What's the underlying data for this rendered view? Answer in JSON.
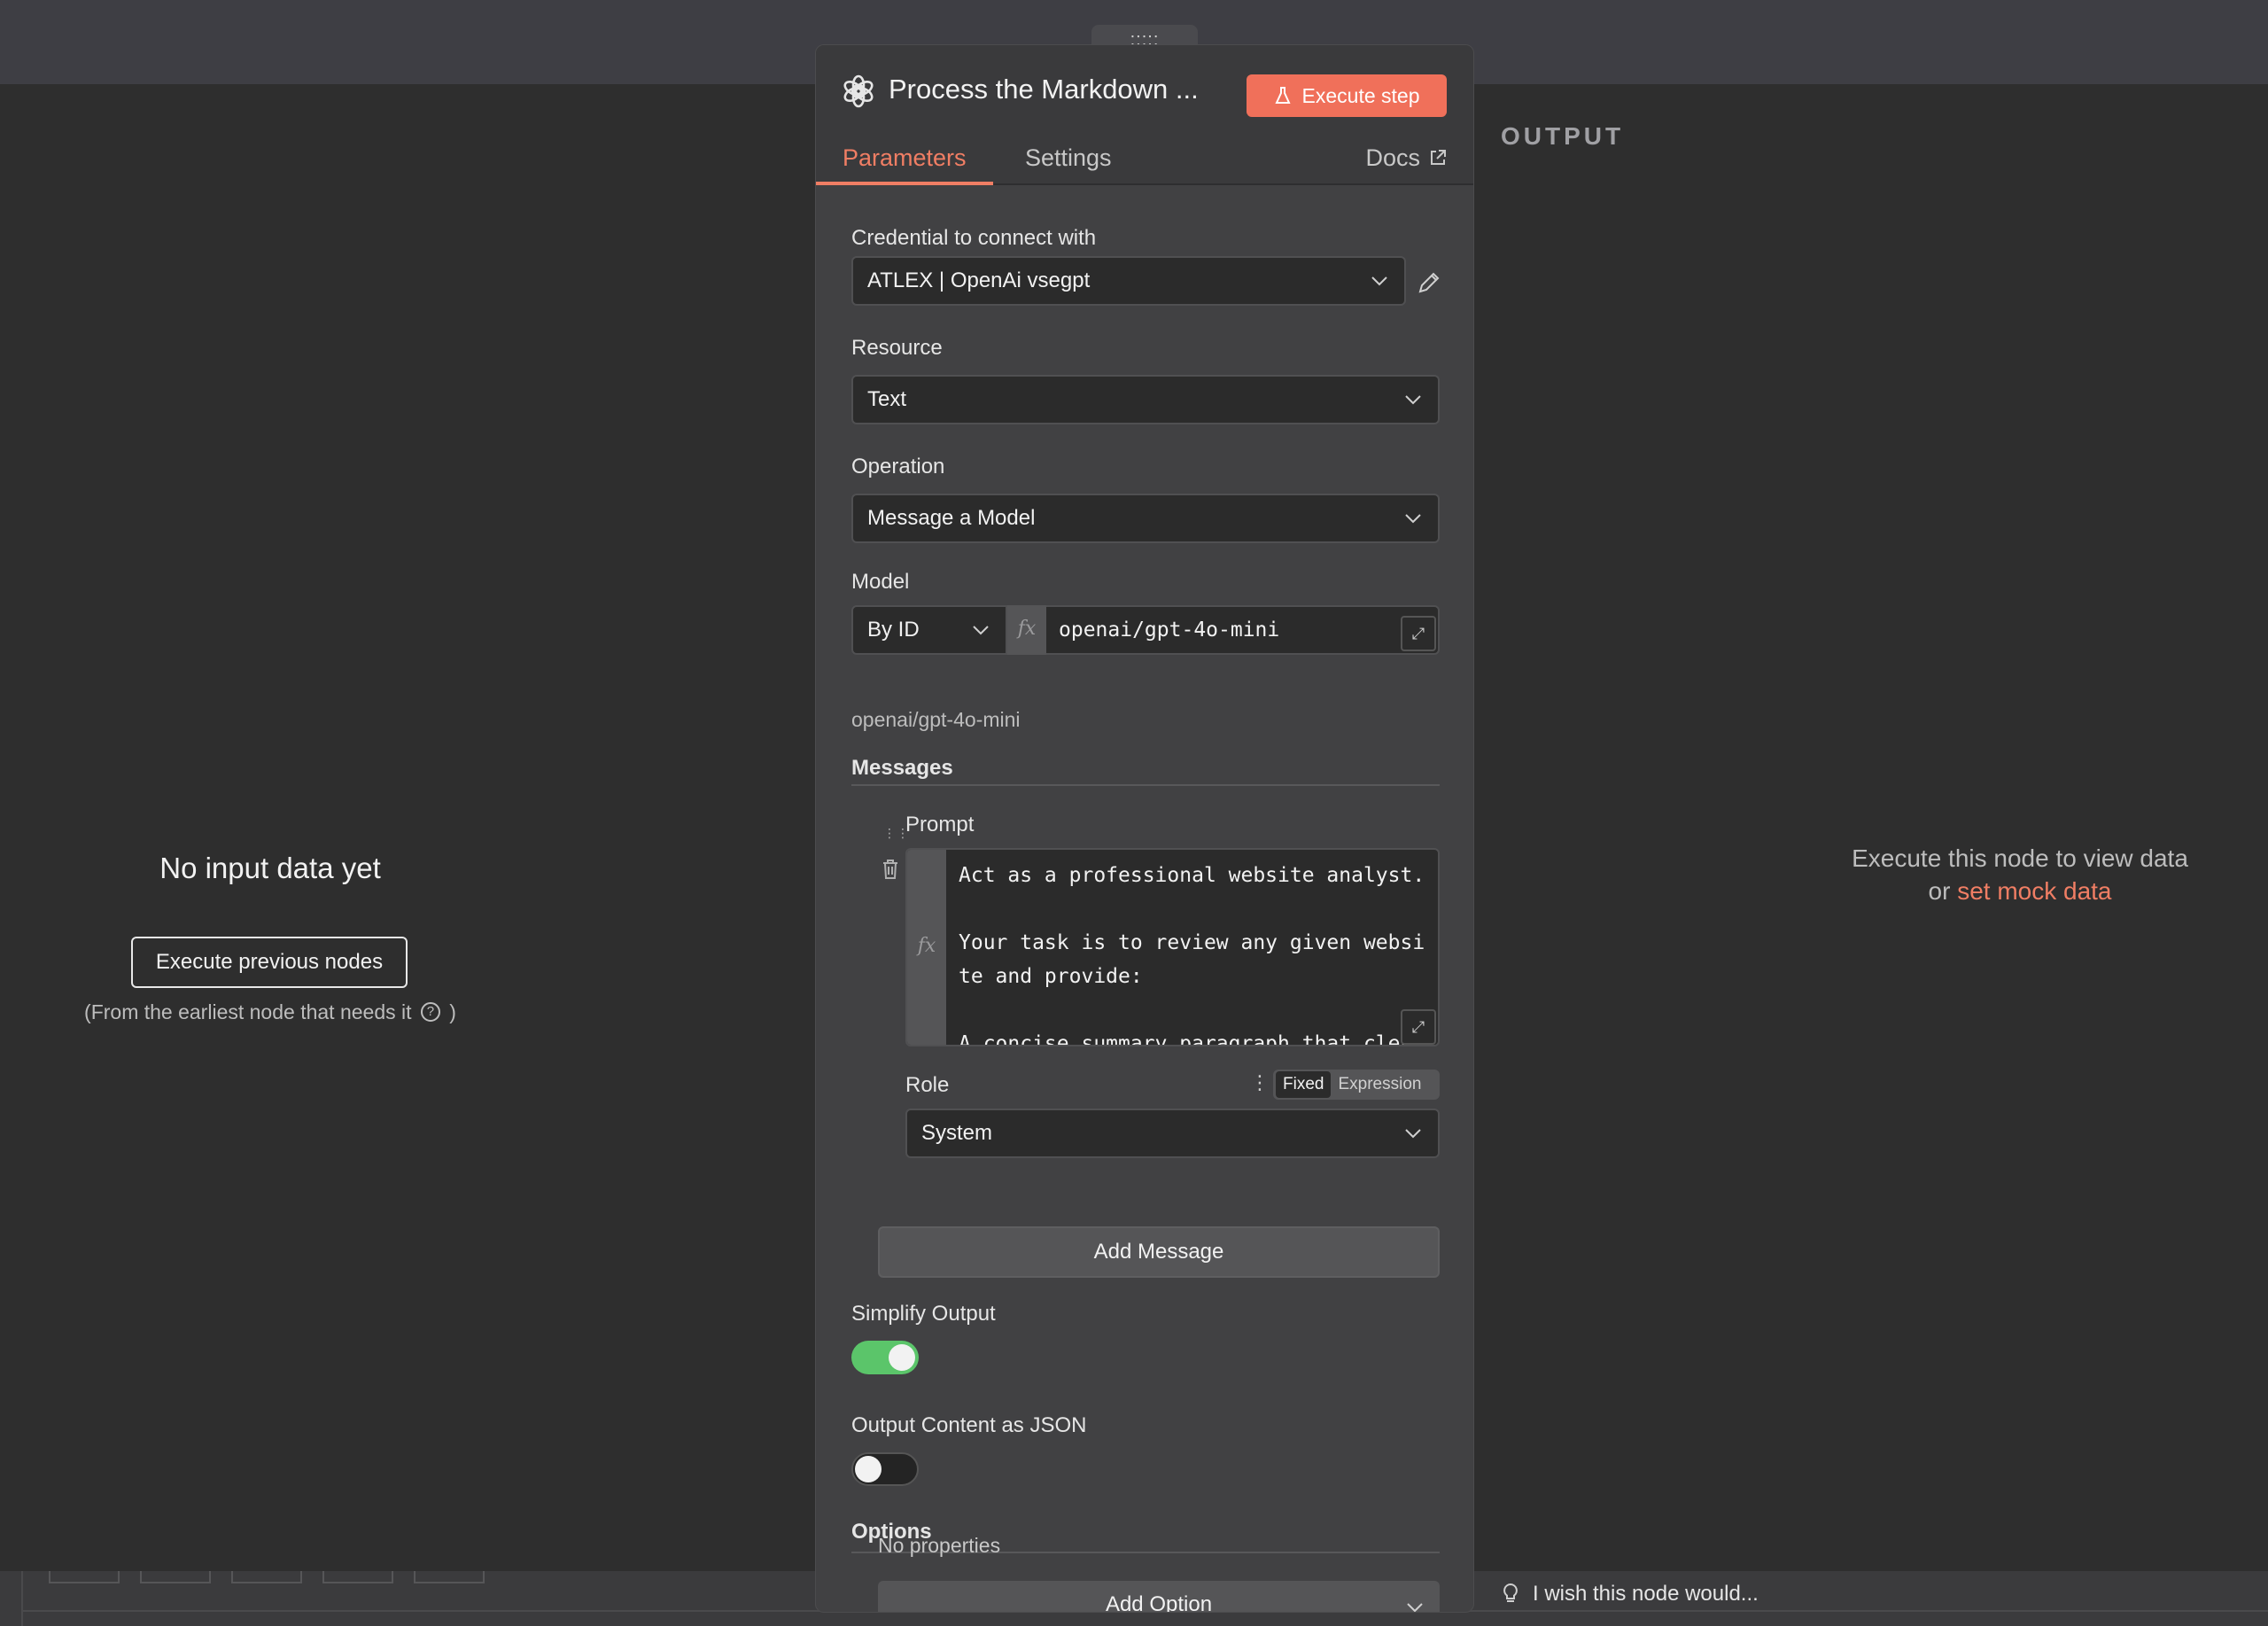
{
  "panel": {
    "title": "Process the Markdown ...",
    "execute_step_label": "Execute step",
    "tabs": [
      {
        "label": "Parameters",
        "active": true
      },
      {
        "label": "Settings",
        "active": false
      }
    ],
    "docs_label": "Docs"
  },
  "drag_handle": ":::::",
  "input_pane": {
    "title": "No input data yet",
    "button_label": "Execute previous nodes",
    "note_prefix": "(From the earliest node that needs it",
    "note_suffix": ")"
  },
  "output_pane": {
    "label": "OUTPUT",
    "message": "Execute this node to view data",
    "or_text": "or",
    "mock_link": "set mock data",
    "feedback": "I wish this node would..."
  },
  "form": {
    "credential": {
      "label": "Credential to connect with",
      "value": "ATLEX | OpenAi vsegpt"
    },
    "resource": {
      "label": "Resource",
      "value": "Text"
    },
    "operation": {
      "label": "Operation",
      "value": "Message a Model"
    },
    "model": {
      "label": "Model",
      "mode": "By ID",
      "value": "openai/gpt-4o-mini",
      "hint": "openai/gpt-4o-mini"
    },
    "messages": {
      "section_title": "Messages",
      "prompt_label": "Prompt",
      "prompt_text": "Act as a professional website analyst.\n\nYour task is to review any given website and provide:\n\nA concise summary paragraph that clearly",
      "role_label": "Role",
      "role_toggle": {
        "fixed": "Fixed",
        "expression": "Expression"
      },
      "role_value": "System",
      "add_button": "Add Message"
    },
    "simplify_output": {
      "label": "Simplify Output",
      "enabled": true
    },
    "output_json": {
      "label": "Output Content as JSON",
      "enabled": false
    },
    "options": {
      "section_title": "Options",
      "empty_text": "No properties",
      "add_button": "Add Option"
    }
  },
  "colors": {
    "accent": "#f07e64",
    "execute_button": "#f0705a",
    "toggle_on": "#5bc56a",
    "panel_bg": "#414143",
    "canvas_bg": "#2e2e2e"
  }
}
